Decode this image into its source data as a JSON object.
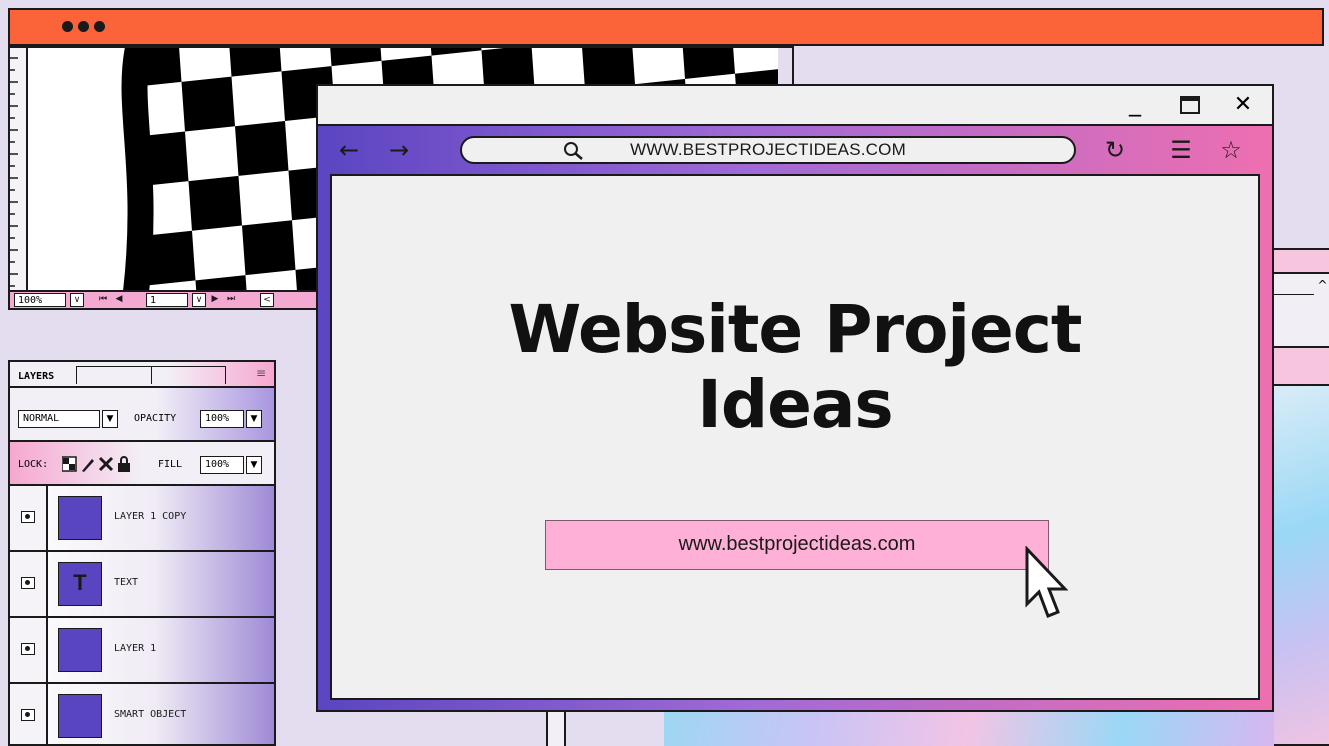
{
  "topbar": {
    "dots": 3,
    "color": "#fb6438"
  },
  "canvas_status": {
    "zoom": "100%",
    "page": "1",
    "dropdown_glyph": "∨",
    "first_glyph": "⏮",
    "prev_glyph": "◀",
    "next_glyph": "▶",
    "last_glyph": "⏭",
    "scroll_glyph": "<"
  },
  "layers_panel": {
    "tab_label": "LAYERS",
    "menu_icon": "≡",
    "blend_mode": "NORMAL",
    "opacity_label": "OPACITY",
    "opacity_value": "100%",
    "lock_label": "LOCK:",
    "fill_label": "FILL",
    "fill_value": "100%",
    "layers": [
      {
        "name": "LAYER 1 COPY",
        "thumb_text": ""
      },
      {
        "name": "TEXT",
        "thumb_text": "T"
      },
      {
        "name": "LAYER 1",
        "thumb_text": ""
      },
      {
        "name": "SMART OBJECT",
        "thumb_text": ""
      }
    ]
  },
  "browser": {
    "url": "WWW.BESTPROJECTIDEAS.COM",
    "back_icon": "←",
    "forward_icon": "→",
    "refresh_icon": "↻",
    "menu_icon": "☰",
    "bookmark_icon": "☆",
    "minimize_icon": "_",
    "maximize_icon": "□",
    "close_icon": "✕",
    "headline_line1": "Website Project",
    "headline_line2": "Ideas",
    "link_text": "www.bestprojectideas.com"
  },
  "colors": {
    "accent_orange": "#fb6438",
    "accent_purple": "#5b45c2",
    "accent_pink": "#ee6fb0",
    "link_pink": "#ffb0d6"
  }
}
